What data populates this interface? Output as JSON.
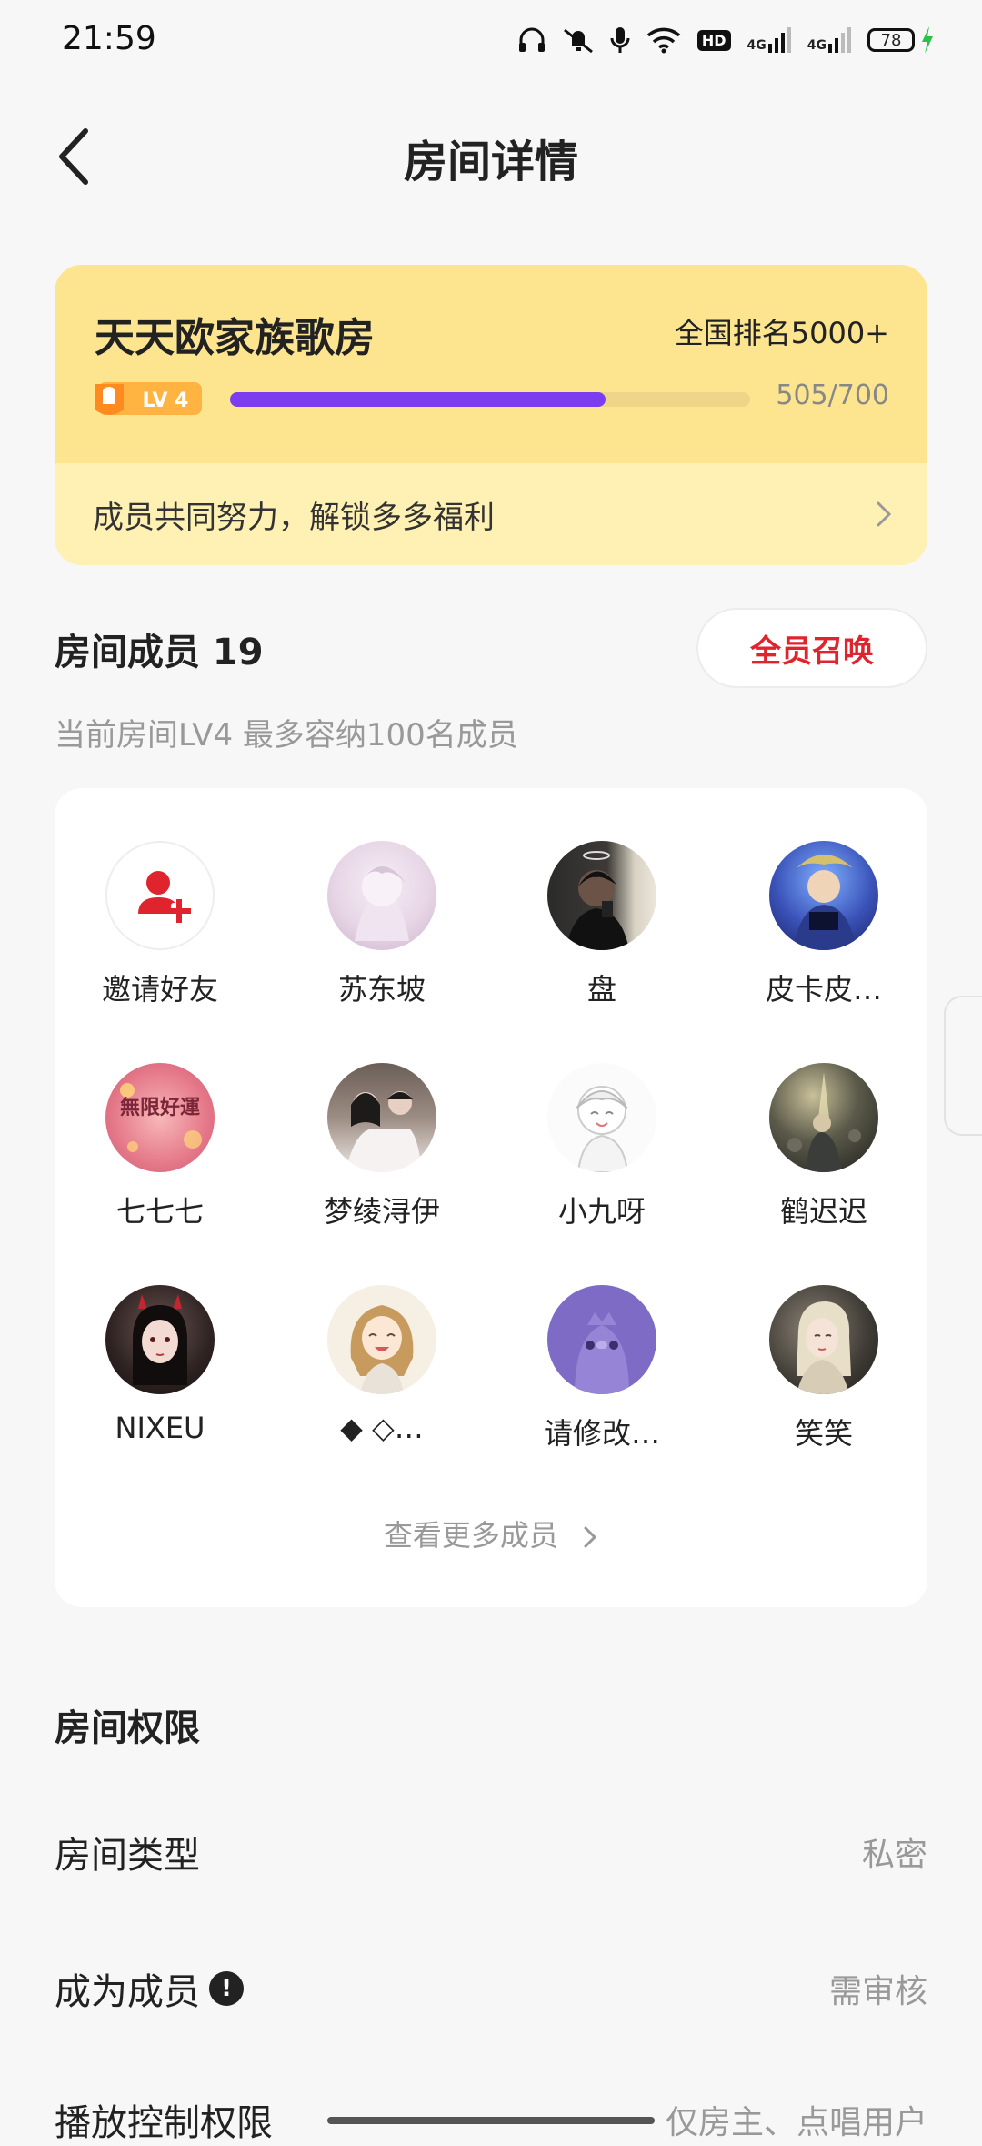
{
  "status_bar": {
    "time": "21:59",
    "battery": "78",
    "network_1": "4G",
    "network_2": "4G",
    "hd": "HD"
  },
  "header": {
    "title": "房间详情",
    "back_icon": "chevron-left-icon"
  },
  "level_card": {
    "room_name": "天天欧家族歌房",
    "rank": "全国排名5000+",
    "level_badge": "LV 4",
    "progress_current": 505,
    "progress_max": 700,
    "progress_text": "505/700",
    "benefit_text": "成员共同努力，解锁多多福利",
    "progress_color": "#7c3cf0"
  },
  "members": {
    "title": "房间成员 19",
    "summon_button": "全员召唤",
    "subtitle": "当前房间LV4 最多容纳100名成员",
    "list": [
      {
        "name": "邀请好友"
      },
      {
        "name": "苏东坡"
      },
      {
        "name": "盘"
      },
      {
        "name": "皮卡皮…"
      },
      {
        "name": "七七七"
      },
      {
        "name": "梦绫浔伊"
      },
      {
        "name": "小九呀"
      },
      {
        "name": "鹤迟迟"
      },
      {
        "name": "NIXEU"
      },
      {
        "name": "◆ ◇…"
      },
      {
        "name": "请修改…"
      },
      {
        "name": "笑笑"
      }
    ],
    "more_link": "查看更多成员",
    "avatar_text_7": "無限好運"
  },
  "permissions": {
    "title": "房间权限",
    "rows": [
      {
        "label": "房间类型",
        "value": "私密"
      },
      {
        "label": "成为成员",
        "value": "需审核"
      },
      {
        "label": "播放控制权限",
        "value": "仅房主、点唱用户"
      }
    ]
  },
  "accent_colors": {
    "card_yellow": "#fde590",
    "card_light": "#fff1b3",
    "summon_red": "#e0242d"
  }
}
